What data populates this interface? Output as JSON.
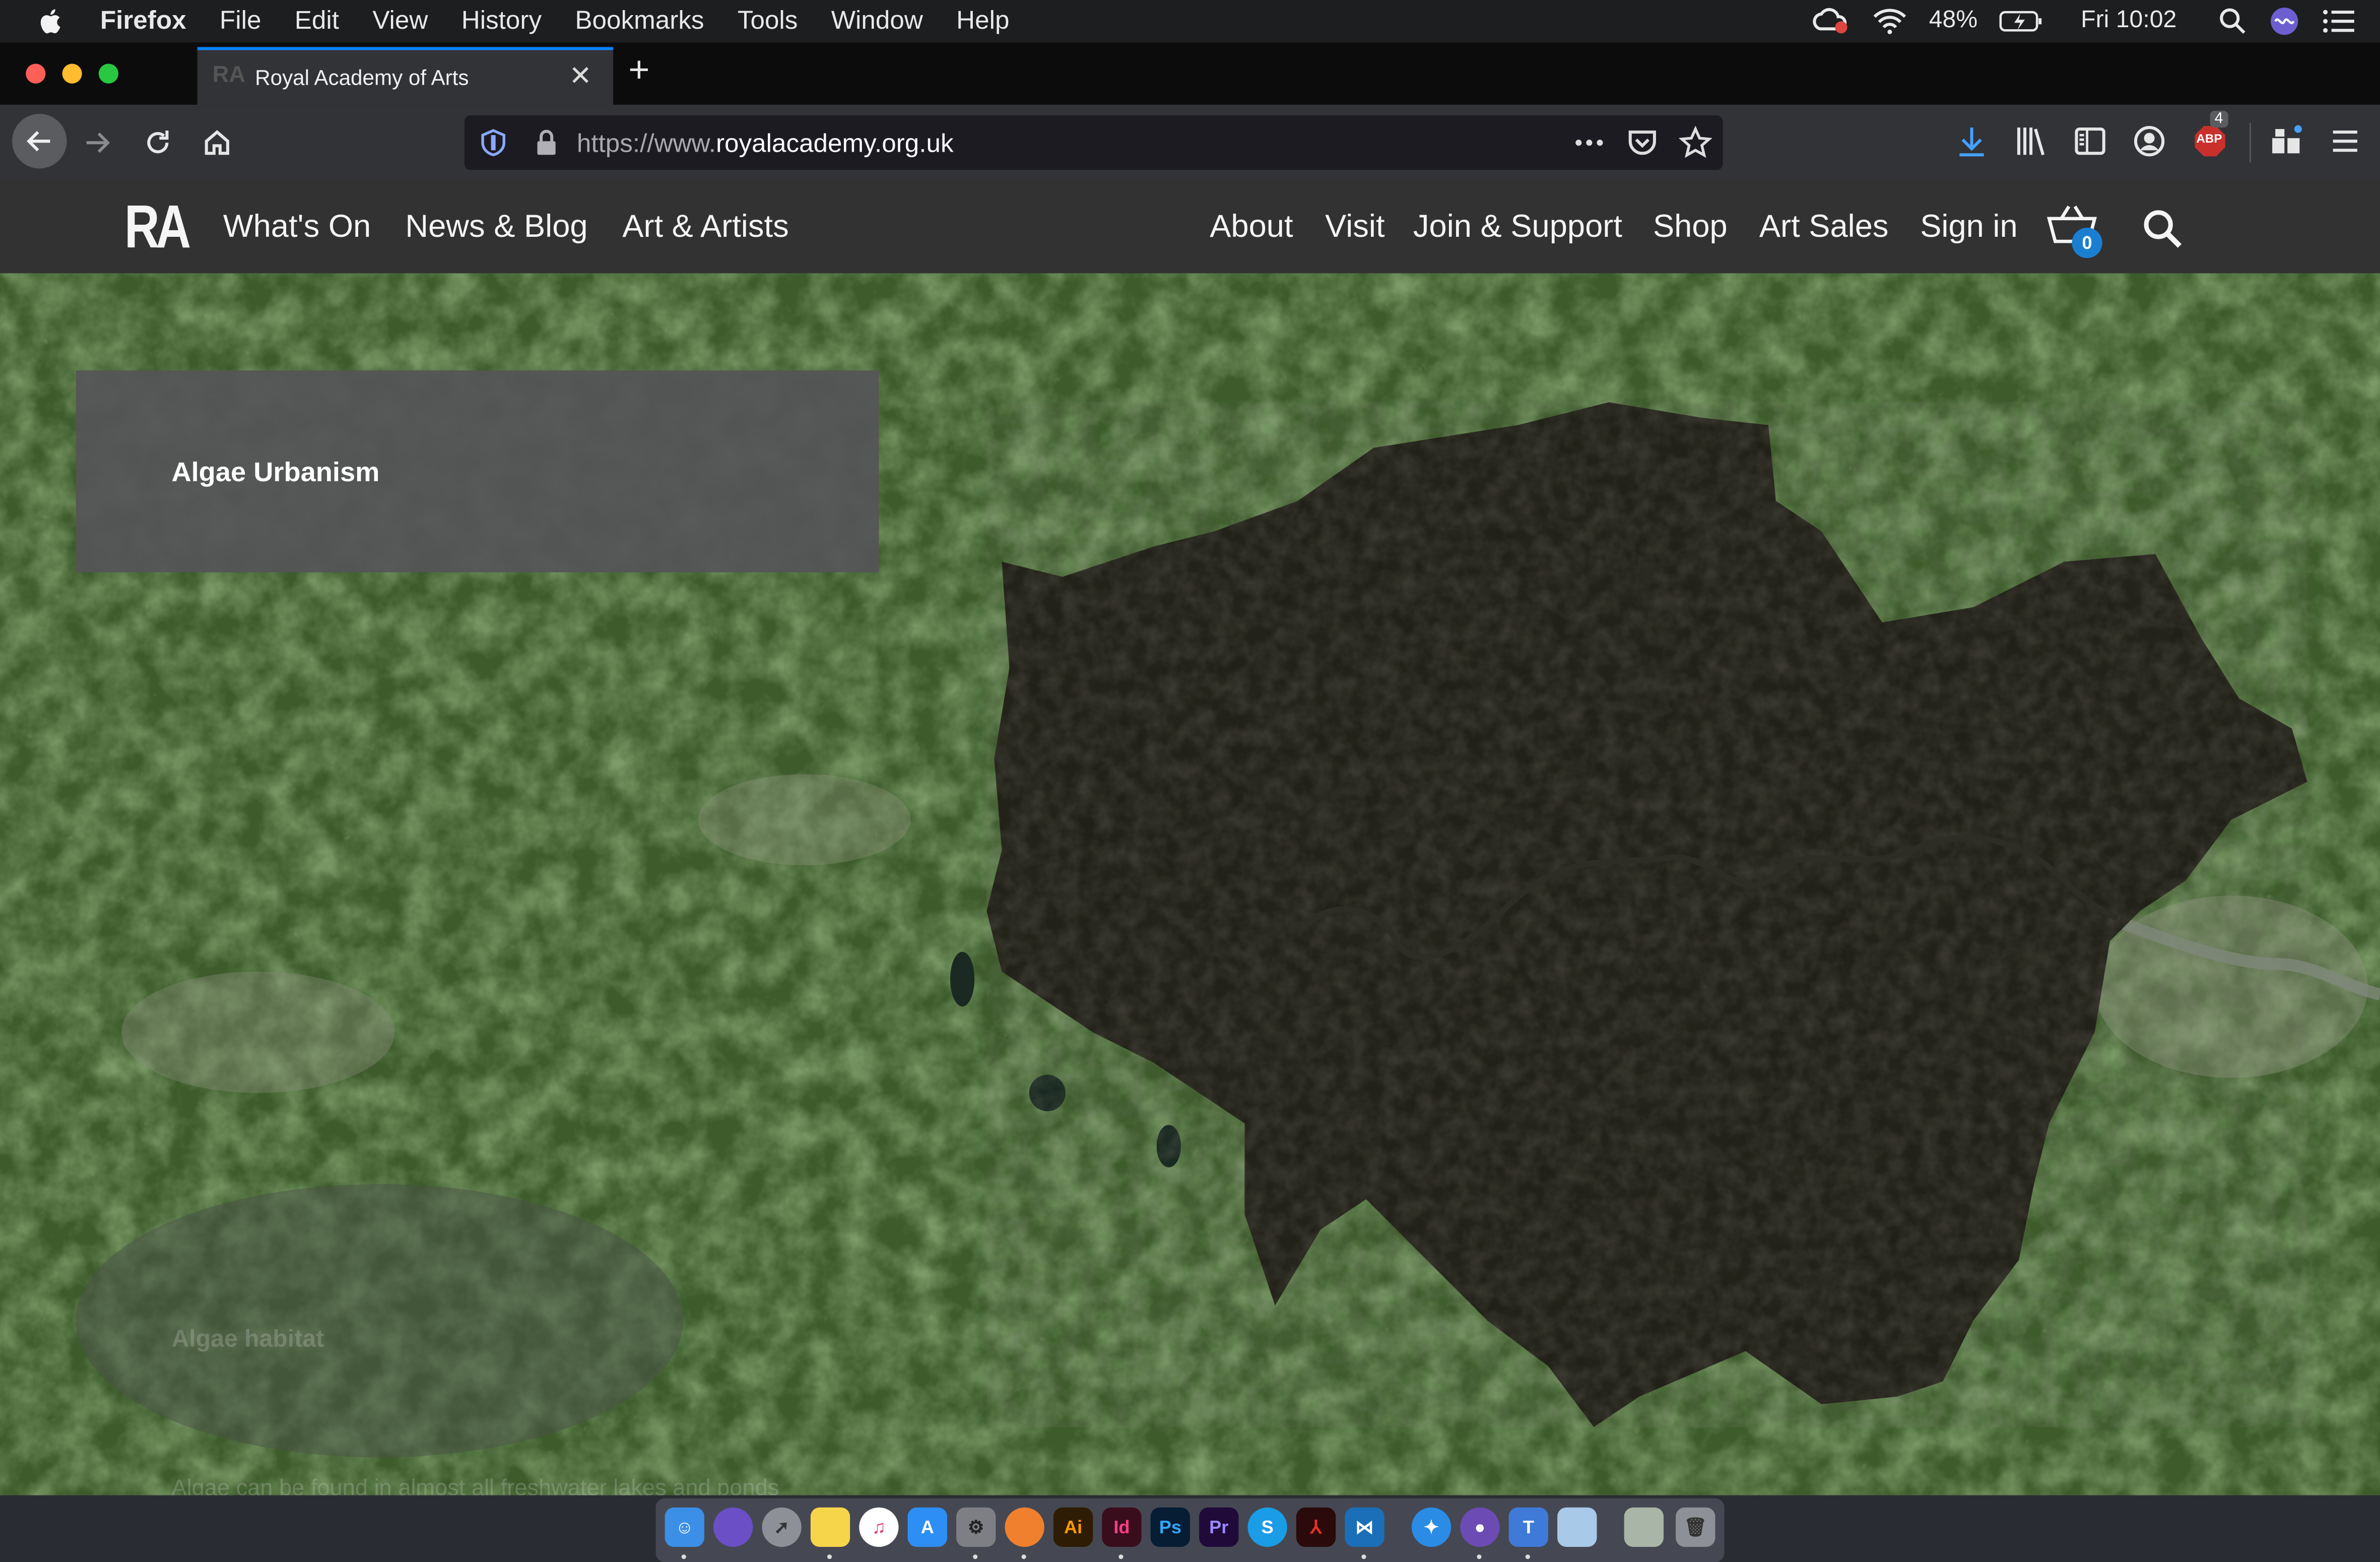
{
  "menubar": {
    "app_name": "Firefox",
    "items": [
      "File",
      "Edit",
      "View",
      "History",
      "Bookmarks",
      "Tools",
      "Window",
      "Help"
    ],
    "battery": "48%",
    "clock": "Fri 10:02"
  },
  "browser": {
    "tab_title": "Royal Academy of Arts",
    "tab_favicon_text": "RA",
    "url_prefix": "https://www.",
    "url_domain": "royalacademy.org.uk",
    "addon_badge": "4",
    "addon_label": "ABP"
  },
  "site": {
    "logo": "RA",
    "nav_left": [
      "What's On",
      "News & Blog",
      "Art & Artists"
    ],
    "nav_right": [
      "About",
      "Visit",
      "Join & Support",
      "Shop",
      "Art Sales",
      "Sign in"
    ],
    "basket_count": "0"
  },
  "map": {
    "card_title": "Algae Urbanism",
    "faded_label_1": "Algae habitat",
    "faded_label_2": "Algae can be found in almost all freshwater lakes and ponds"
  },
  "dock": {
    "apps": [
      "Finder",
      "Siri",
      "Launchpad",
      "Notes",
      "iTunes",
      "App Store",
      "System Preferences",
      "Firefox",
      "Ai",
      "Id",
      "Ps",
      "Pr",
      "Skype",
      "Acrobat",
      "VS Code",
      "Safari",
      "GitHub",
      "Keynote",
      "Preview",
      "Downloads",
      "Trash"
    ]
  },
  "colors": {
    "accent_tab": "#0a84ff",
    "download_arrow": "#45a1ff",
    "badge_blue": "#1b7fd1",
    "abp_red": "#c9302c"
  }
}
